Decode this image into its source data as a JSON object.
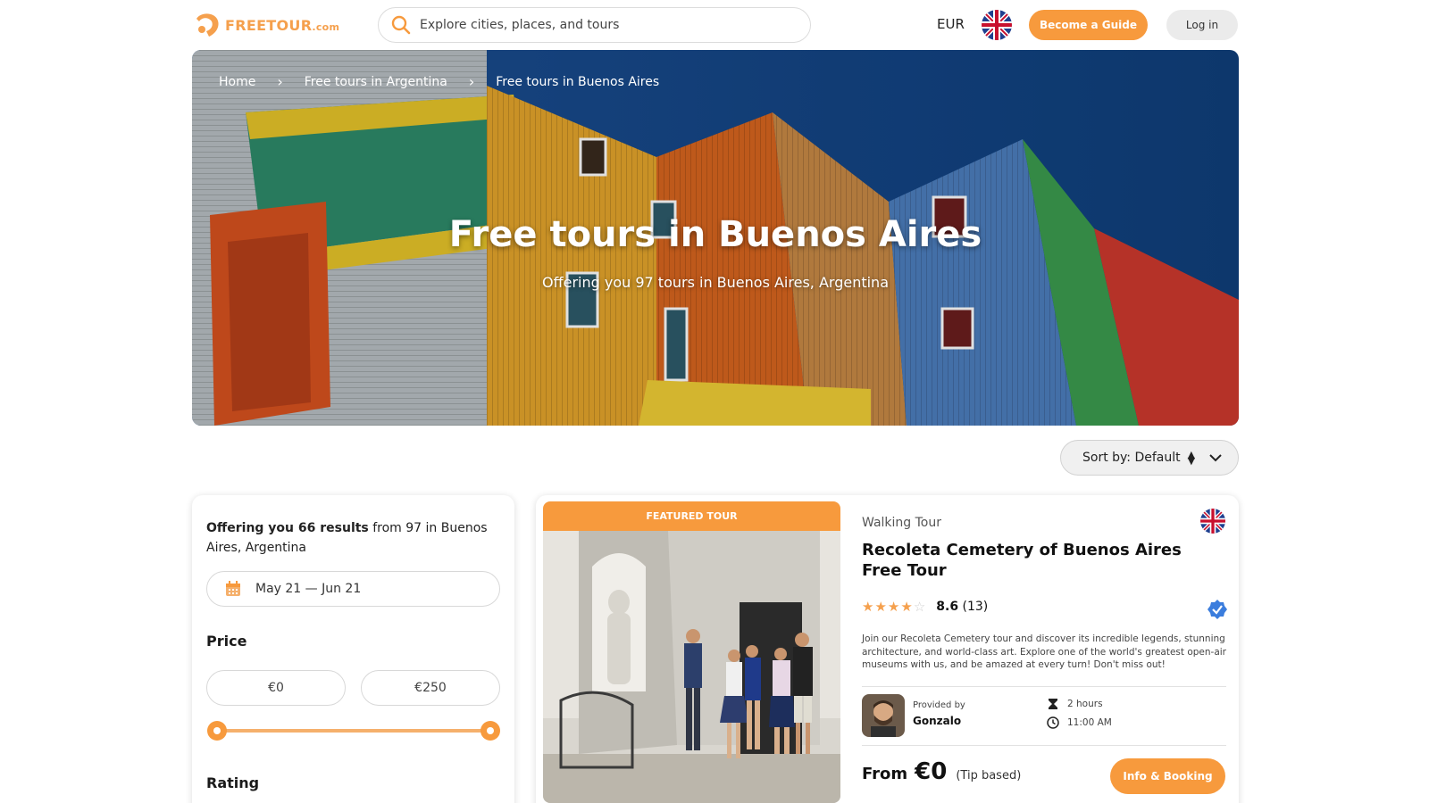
{
  "header": {
    "logo_text": "FREETOUR",
    "logo_suffix": ".com",
    "search_placeholder": "Explore cities, places, and tours",
    "currency": "EUR",
    "become_guide_label": "Become a Guide",
    "login_label": "Log in"
  },
  "hero": {
    "breadcrumb": [
      "Home",
      "Free tours in Argentina",
      "Free tours in Buenos Aires"
    ],
    "title": "Free tours in Buenos Aires",
    "subtitle": "Offering you 97 tours in Buenos Aires, Argentina"
  },
  "sort": {
    "label": "Sort by: Default"
  },
  "filters": {
    "results_bold": "Offering you 66 results",
    "results_rest": " from 97 in Buenos Aires, Argentina",
    "date_range": "May 21 — Jun 21",
    "price_label": "Price",
    "price_min": "€0",
    "price_max": "€250",
    "rating_label": "Rating"
  },
  "tour": {
    "badge": "FEATURED TOUR",
    "type": "Walking Tour",
    "title": "Recoleta Cemetery of Buenos Aires Free Tour",
    "stars": 4.3,
    "score": "8.6",
    "reviews": "(13)",
    "description": "Join our Recoleta Cemetery tour and discover its incredible legends, stunning architecture, and world-class art. Explore one of the world's greatest open-air museums with us, and be amazed at every turn! Don't miss out!",
    "provided_by_label": "Provided by",
    "guide_name": "Gonzalo",
    "duration": "2 hours",
    "start_time": "11:00 AM",
    "from_label": "From",
    "price": "€0",
    "price_note": "(Tip based)",
    "booking_label": "Info & Booking"
  },
  "colors": {
    "accent": "#f79a3d",
    "verified": "#3b7ddd"
  }
}
